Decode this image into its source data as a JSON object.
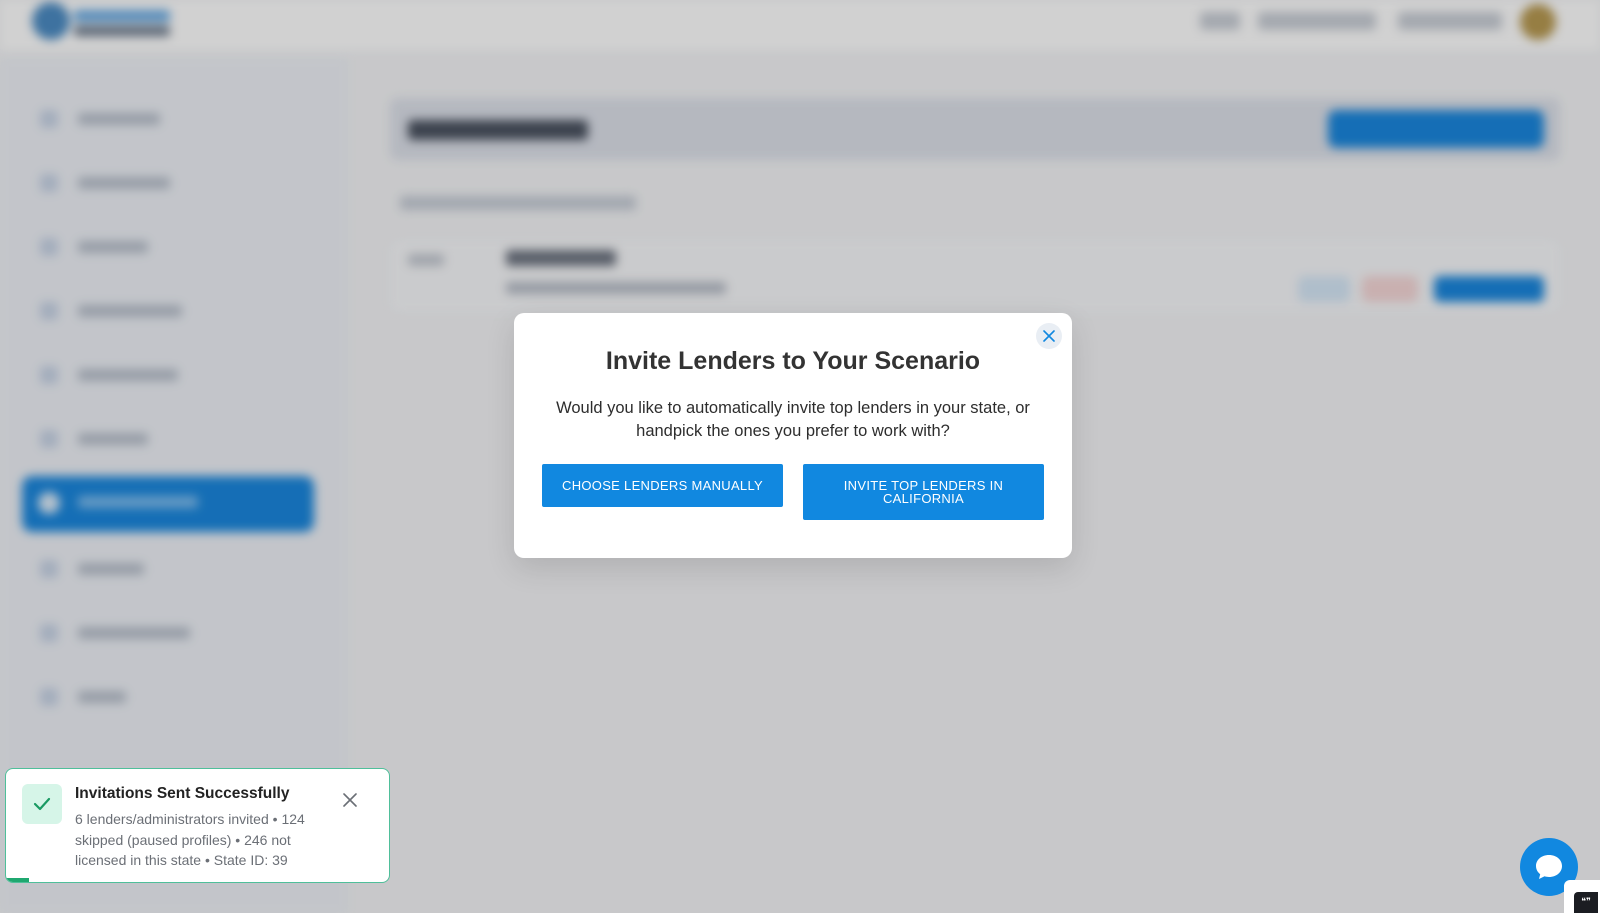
{
  "modal": {
    "title": "Invite Lenders to Your Scenario",
    "description": "Would you like to automatically invite top lenders in your state, or handpick the ones you prefer to work with?",
    "manual_button": "CHOOSE LENDERS MANUALLY",
    "invite_button": "INVITE TOP LENDERS IN CALIFORNIA",
    "close_icon": "close-icon"
  },
  "toast": {
    "title": "Invitations Sent Successfully",
    "body": "6 lenders/administrators invited • 124 skipped (paused profiles) • 246 not licensed in this state • State ID: 39",
    "status_icon": "check-icon",
    "close_icon": "close-icon",
    "progress_remaining": 0.06
  },
  "chat": {
    "icon": "chat-bubble-icon",
    "corner_glyph": "❝❞"
  },
  "colors": {
    "primary": "#1188e0",
    "success_border": "#4fbf9a",
    "success_fill": "#d6f5e8",
    "success_check": "#1a9a63",
    "overlay": "rgba(0,0,0,0.18)"
  }
}
